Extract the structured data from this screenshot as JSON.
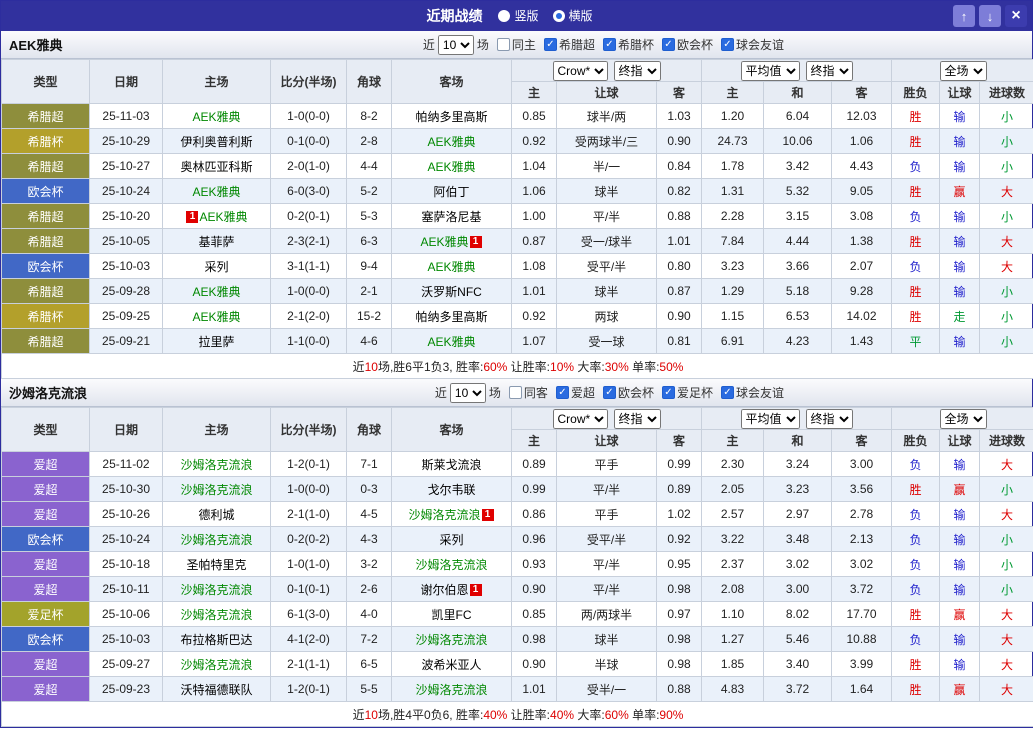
{
  "titlebar": {
    "title": "近期战绩",
    "radios": [
      {
        "label": "竖版",
        "selected": false
      },
      {
        "label": "横版",
        "selected": true
      }
    ]
  },
  "icons": {
    "up_arrow": "↑",
    "down_arrow": "↓",
    "close": "×",
    "check": "✓",
    "red_card": "1"
  },
  "header": {
    "static_cols": [
      "类型",
      "日期",
      "主场",
      "比分(半场)",
      "角球",
      "客场"
    ],
    "handicap_selects": [
      "Crow*",
      "终指"
    ],
    "odds_selects": [
      "平均值",
      "终指"
    ],
    "result_select": "全场",
    "sub_cols": [
      "主",
      "让球",
      "客",
      "主",
      "和",
      "客",
      "胜负",
      "让球",
      "进球数"
    ]
  },
  "badge_colors": {
    "希腊超": "#8e8e3c",
    "希腊杯": "#b3a02b",
    "欧会杯": "#4168c6",
    "爱超": "#8a63cf",
    "爱足杯": "#a3a32b"
  },
  "result_colors": {
    "red": "#dd0000",
    "blue": "#2020cc",
    "green": "#009933"
  },
  "sections": [
    {
      "team": "AEK雅典",
      "filter": {
        "prefix": "近",
        "count": "10",
        "suffix": "场",
        "checkboxes": [
          {
            "label": "同主",
            "checked": false
          },
          {
            "label": "希腊超",
            "checked": true
          },
          {
            "label": "希腊杯",
            "checked": true
          },
          {
            "label": "欧会杯",
            "checked": true
          },
          {
            "label": "球会友谊",
            "checked": true
          }
        ]
      },
      "rows": [
        {
          "type": "希腊超",
          "date": "25-11-03",
          "home": {
            "name": "AEK雅典",
            "focus": true,
            "card": ""
          },
          "score": "1-0(0-0)",
          "corner": "8-2",
          "away": {
            "name": "帕纳多里高斯",
            "focus": false,
            "card": ""
          },
          "ah": [
            "0.85",
            "球半/两",
            "1.03"
          ],
          "eu": [
            "1.20",
            "6.04",
            "12.03"
          ],
          "res": [
            {
              "t": "胜",
              "c": "red"
            },
            {
              "t": "输",
              "c": "blue"
            },
            {
              "t": "小",
              "c": "green"
            }
          ]
        },
        {
          "type": "希腊杯",
          "date": "25-10-29",
          "home": {
            "name": "伊利奥普利斯",
            "focus": false,
            "card": ""
          },
          "score": "0-1(0-0)",
          "corner": "2-8",
          "away": {
            "name": "AEK雅典",
            "focus": true,
            "card": ""
          },
          "ah": [
            "0.92",
            "受两球半/三",
            "0.90"
          ],
          "eu": [
            "24.73",
            "10.06",
            "1.06"
          ],
          "res": [
            {
              "t": "胜",
              "c": "red"
            },
            {
              "t": "输",
              "c": "blue"
            },
            {
              "t": "小",
              "c": "green"
            }
          ]
        },
        {
          "type": "希腊超",
          "date": "25-10-27",
          "home": {
            "name": "奥林匹亚科斯",
            "focus": false,
            "card": ""
          },
          "score": "2-0(1-0)",
          "corner": "4-4",
          "away": {
            "name": "AEK雅典",
            "focus": true,
            "card": ""
          },
          "ah": [
            "1.04",
            "半/一",
            "0.84"
          ],
          "eu": [
            "1.78",
            "3.42",
            "4.43"
          ],
          "res": [
            {
              "t": "负",
              "c": "blue"
            },
            {
              "t": "输",
              "c": "blue"
            },
            {
              "t": "小",
              "c": "green"
            }
          ]
        },
        {
          "type": "欧会杯",
          "date": "25-10-24",
          "home": {
            "name": "AEK雅典",
            "focus": true,
            "card": ""
          },
          "score": "6-0(3-0)",
          "corner": "5-2",
          "away": {
            "name": "阿伯丁",
            "focus": false,
            "card": ""
          },
          "ah": [
            "1.06",
            "球半",
            "0.82"
          ],
          "eu": [
            "1.31",
            "5.32",
            "9.05"
          ],
          "res": [
            {
              "t": "胜",
              "c": "red"
            },
            {
              "t": "赢",
              "c": "red"
            },
            {
              "t": "大",
              "c": "red"
            }
          ]
        },
        {
          "type": "希腊超",
          "date": "25-10-20",
          "home": {
            "name": "AEK雅典",
            "focus": true,
            "card": "pre"
          },
          "score": "0-2(0-1)",
          "corner": "5-3",
          "away": {
            "name": "塞萨洛尼基",
            "focus": false,
            "card": ""
          },
          "ah": [
            "1.00",
            "平/半",
            "0.88"
          ],
          "eu": [
            "2.28",
            "3.15",
            "3.08"
          ],
          "res": [
            {
              "t": "负",
              "c": "blue"
            },
            {
              "t": "输",
              "c": "blue"
            },
            {
              "t": "小",
              "c": "green"
            }
          ]
        },
        {
          "type": "希腊超",
          "date": "25-10-05",
          "home": {
            "name": "基菲萨",
            "focus": false,
            "card": ""
          },
          "score": "2-3(2-1)",
          "corner": "6-3",
          "away": {
            "name": "AEK雅典",
            "focus": true,
            "card": "post"
          },
          "ah": [
            "0.87",
            "受一/球半",
            "1.01"
          ],
          "eu": [
            "7.84",
            "4.44",
            "1.38"
          ],
          "res": [
            {
              "t": "胜",
              "c": "red"
            },
            {
              "t": "输",
              "c": "blue"
            },
            {
              "t": "大",
              "c": "red"
            }
          ]
        },
        {
          "type": "欧会杯",
          "date": "25-10-03",
          "home": {
            "name": "采列",
            "focus": false,
            "card": ""
          },
          "score": "3-1(1-1)",
          "corner": "9-4",
          "away": {
            "name": "AEK雅典",
            "focus": true,
            "card": ""
          },
          "ah": [
            "1.08",
            "受平/半",
            "0.80"
          ],
          "eu": [
            "3.23",
            "3.66",
            "2.07"
          ],
          "res": [
            {
              "t": "负",
              "c": "blue"
            },
            {
              "t": "输",
              "c": "blue"
            },
            {
              "t": "大",
              "c": "red"
            }
          ]
        },
        {
          "type": "希腊超",
          "date": "25-09-28",
          "home": {
            "name": "AEK雅典",
            "focus": true,
            "card": ""
          },
          "score": "1-0(0-0)",
          "corner": "2-1",
          "away": {
            "name": "沃罗斯NFC",
            "focus": false,
            "card": ""
          },
          "ah": [
            "1.01",
            "球半",
            "0.87"
          ],
          "eu": [
            "1.29",
            "5.18",
            "9.28"
          ],
          "res": [
            {
              "t": "胜",
              "c": "red"
            },
            {
              "t": "输",
              "c": "blue"
            },
            {
              "t": "小",
              "c": "green"
            }
          ]
        },
        {
          "type": "希腊杯",
          "date": "25-09-25",
          "home": {
            "name": "AEK雅典",
            "focus": true,
            "card": ""
          },
          "score": "2-1(2-0)",
          "corner": "15-2",
          "away": {
            "name": "帕纳多里高斯",
            "focus": false,
            "card": ""
          },
          "ah": [
            "0.92",
            "两球",
            "0.90"
          ],
          "eu": [
            "1.15",
            "6.53",
            "14.02"
          ],
          "res": [
            {
              "t": "胜",
              "c": "red"
            },
            {
              "t": "走",
              "c": "green"
            },
            {
              "t": "小",
              "c": "green"
            }
          ]
        },
        {
          "type": "希腊超",
          "date": "25-09-21",
          "home": {
            "name": "拉里萨",
            "focus": false,
            "card": ""
          },
          "score": "1-1(0-0)",
          "corner": "4-6",
          "away": {
            "name": "AEK雅典",
            "focus": true,
            "card": ""
          },
          "ah": [
            "1.07",
            "受一球",
            "0.81"
          ],
          "eu": [
            "6.91",
            "4.23",
            "1.43"
          ],
          "res": [
            {
              "t": "平",
              "c": "green"
            },
            {
              "t": "输",
              "c": "blue"
            },
            {
              "t": "小",
              "c": "green"
            }
          ]
        }
      ],
      "summary": [
        {
          "t": "近",
          "c": ""
        },
        {
          "t": "10",
          "c": "red"
        },
        {
          "t": "场,胜6平1负3, 胜率:",
          "c": ""
        },
        {
          "t": "60%",
          "c": "red"
        },
        {
          "t": " 让胜率:",
          "c": ""
        },
        {
          "t": "10%",
          "c": "red"
        },
        {
          "t": " 大率:",
          "c": ""
        },
        {
          "t": "30%",
          "c": "red"
        },
        {
          "t": " 单率:",
          "c": ""
        },
        {
          "t": "50%",
          "c": "red"
        }
      ]
    },
    {
      "team": "沙姆洛克流浪",
      "filter": {
        "prefix": "近",
        "count": "10",
        "suffix": "场",
        "checkboxes": [
          {
            "label": "同客",
            "checked": false
          },
          {
            "label": "爱超",
            "checked": true
          },
          {
            "label": "欧会杯",
            "checked": true
          },
          {
            "label": "爱足杯",
            "checked": true
          },
          {
            "label": "球会友谊",
            "checked": true
          }
        ]
      },
      "rows": [
        {
          "type": "爱超",
          "date": "25-11-02",
          "home": {
            "name": "沙姆洛克流浪",
            "focus": true,
            "card": ""
          },
          "score": "1-2(0-1)",
          "corner": "7-1",
          "away": {
            "name": "斯莱戈流浪",
            "focus": false,
            "card": ""
          },
          "ah": [
            "0.89",
            "平手",
            "0.99"
          ],
          "eu": [
            "2.30",
            "3.24",
            "3.00"
          ],
          "res": [
            {
              "t": "负",
              "c": "blue"
            },
            {
              "t": "输",
              "c": "blue"
            },
            {
              "t": "大",
              "c": "red"
            }
          ]
        },
        {
          "type": "爱超",
          "date": "25-10-30",
          "home": {
            "name": "沙姆洛克流浪",
            "focus": true,
            "card": ""
          },
          "score": "1-0(0-0)",
          "corner": "0-3",
          "away": {
            "name": "戈尔韦联",
            "focus": false,
            "card": ""
          },
          "ah": [
            "0.99",
            "平/半",
            "0.89"
          ],
          "eu": [
            "2.05",
            "3.23",
            "3.56"
          ],
          "res": [
            {
              "t": "胜",
              "c": "red"
            },
            {
              "t": "赢",
              "c": "red"
            },
            {
              "t": "小",
              "c": "green"
            }
          ]
        },
        {
          "type": "爱超",
          "date": "25-10-26",
          "home": {
            "name": "德利城",
            "focus": false,
            "card": ""
          },
          "score": "2-1(1-0)",
          "corner": "4-5",
          "away": {
            "name": "沙姆洛克流浪",
            "focus": true,
            "card": "post"
          },
          "ah": [
            "0.86",
            "平手",
            "1.02"
          ],
          "eu": [
            "2.57",
            "2.97",
            "2.78"
          ],
          "res": [
            {
              "t": "负",
              "c": "blue"
            },
            {
              "t": "输",
              "c": "blue"
            },
            {
              "t": "大",
              "c": "red"
            }
          ]
        },
        {
          "type": "欧会杯",
          "date": "25-10-24",
          "home": {
            "name": "沙姆洛克流浪",
            "focus": true,
            "card": ""
          },
          "score": "0-2(0-2)",
          "corner": "4-3",
          "away": {
            "name": "采列",
            "focus": false,
            "card": ""
          },
          "ah": [
            "0.96",
            "受平/半",
            "0.92"
          ],
          "eu": [
            "3.22",
            "3.48",
            "2.13"
          ],
          "res": [
            {
              "t": "负",
              "c": "blue"
            },
            {
              "t": "输",
              "c": "blue"
            },
            {
              "t": "小",
              "c": "green"
            }
          ]
        },
        {
          "type": "爱超",
          "date": "25-10-18",
          "home": {
            "name": "圣帕特里克",
            "focus": false,
            "card": ""
          },
          "score": "1-0(1-0)",
          "corner": "3-2",
          "away": {
            "name": "沙姆洛克流浪",
            "focus": true,
            "card": ""
          },
          "ah": [
            "0.93",
            "平/半",
            "0.95"
          ],
          "eu": [
            "2.37",
            "3.02",
            "3.02"
          ],
          "res": [
            {
              "t": "负",
              "c": "blue"
            },
            {
              "t": "输",
              "c": "blue"
            },
            {
              "t": "小",
              "c": "green"
            }
          ]
        },
        {
          "type": "爱超",
          "date": "25-10-11",
          "home": {
            "name": "沙姆洛克流浪",
            "focus": true,
            "card": ""
          },
          "score": "0-1(0-1)",
          "corner": "2-6",
          "away": {
            "name": "谢尔伯恩",
            "focus": false,
            "card": "post"
          },
          "ah": [
            "0.90",
            "平/半",
            "0.98"
          ],
          "eu": [
            "2.08",
            "3.00",
            "3.72"
          ],
          "res": [
            {
              "t": "负",
              "c": "blue"
            },
            {
              "t": "输",
              "c": "blue"
            },
            {
              "t": "小",
              "c": "green"
            }
          ]
        },
        {
          "type": "爱足杯",
          "date": "25-10-06",
          "home": {
            "name": "沙姆洛克流浪",
            "focus": true,
            "card": ""
          },
          "score": "6-1(3-0)",
          "corner": "4-0",
          "away": {
            "name": "凯里FC",
            "focus": false,
            "card": ""
          },
          "ah": [
            "0.85",
            "两/两球半",
            "0.97"
          ],
          "eu": [
            "1.10",
            "8.02",
            "17.70"
          ],
          "res": [
            {
              "t": "胜",
              "c": "red"
            },
            {
              "t": "赢",
              "c": "red"
            },
            {
              "t": "大",
              "c": "red"
            }
          ]
        },
        {
          "type": "欧会杯",
          "date": "25-10-03",
          "home": {
            "name": "布拉格斯巴达",
            "focus": false,
            "card": ""
          },
          "score": "4-1(2-0)",
          "corner": "7-2",
          "away": {
            "name": "沙姆洛克流浪",
            "focus": true,
            "card": ""
          },
          "ah": [
            "0.98",
            "球半",
            "0.98"
          ],
          "eu": [
            "1.27",
            "5.46",
            "10.88"
          ],
          "res": [
            {
              "t": "负",
              "c": "blue"
            },
            {
              "t": "输",
              "c": "blue"
            },
            {
              "t": "大",
              "c": "red"
            }
          ]
        },
        {
          "type": "爱超",
          "date": "25-09-27",
          "home": {
            "name": "沙姆洛克流浪",
            "focus": true,
            "card": ""
          },
          "score": "2-1(1-1)",
          "corner": "6-5",
          "away": {
            "name": "波希米亚人",
            "focus": false,
            "card": ""
          },
          "ah": [
            "0.90",
            "半球",
            "0.98"
          ],
          "eu": [
            "1.85",
            "3.40",
            "3.99"
          ],
          "res": [
            {
              "t": "胜",
              "c": "red"
            },
            {
              "t": "输",
              "c": "blue"
            },
            {
              "t": "大",
              "c": "red"
            }
          ]
        },
        {
          "type": "爱超",
          "date": "25-09-23",
          "home": {
            "name": "沃特福德联队",
            "focus": false,
            "card": ""
          },
          "score": "1-2(0-1)",
          "corner": "5-5",
          "away": {
            "name": "沙姆洛克流浪",
            "focus": true,
            "card": ""
          },
          "ah": [
            "1.01",
            "受半/一",
            "0.88"
          ],
          "eu": [
            "4.83",
            "3.72",
            "1.64"
          ],
          "res": [
            {
              "t": "胜",
              "c": "red"
            },
            {
              "t": "赢",
              "c": "red"
            },
            {
              "t": "大",
              "c": "red"
            }
          ]
        }
      ],
      "summary": [
        {
          "t": "近",
          "c": ""
        },
        {
          "t": "10",
          "c": "red"
        },
        {
          "t": "场,胜4平0负6, 胜率:",
          "c": ""
        },
        {
          "t": "40%",
          "c": "red"
        },
        {
          "t": " 让胜率:",
          "c": ""
        },
        {
          "t": "40%",
          "c": "red"
        },
        {
          "t": " 大率:",
          "c": ""
        },
        {
          "t": "60%",
          "c": "red"
        },
        {
          "t": " 单率:",
          "c": ""
        },
        {
          "t": "90%",
          "c": "red"
        }
      ]
    }
  ]
}
